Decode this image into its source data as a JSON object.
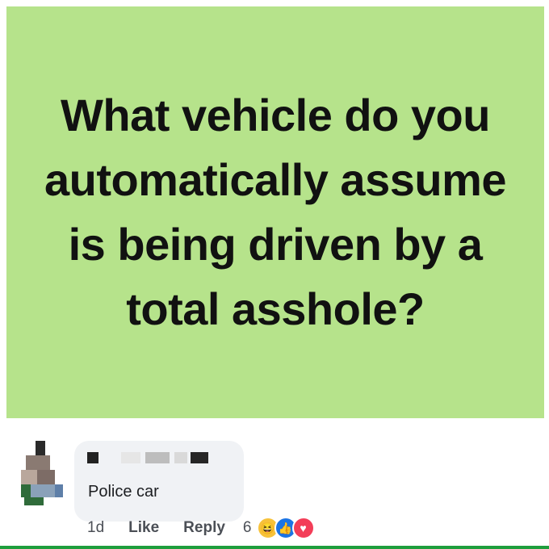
{
  "post": {
    "text": "What vehicle do you automatically assume is being driven by a total asshole?",
    "background_color": "#b6e38b"
  },
  "comment": {
    "text": "Police car",
    "time": "1d",
    "like_label": "Like",
    "reply_label": "Reply",
    "reaction_count": "6",
    "reactions": [
      "haha-icon",
      "like-icon",
      "love-icon"
    ]
  }
}
